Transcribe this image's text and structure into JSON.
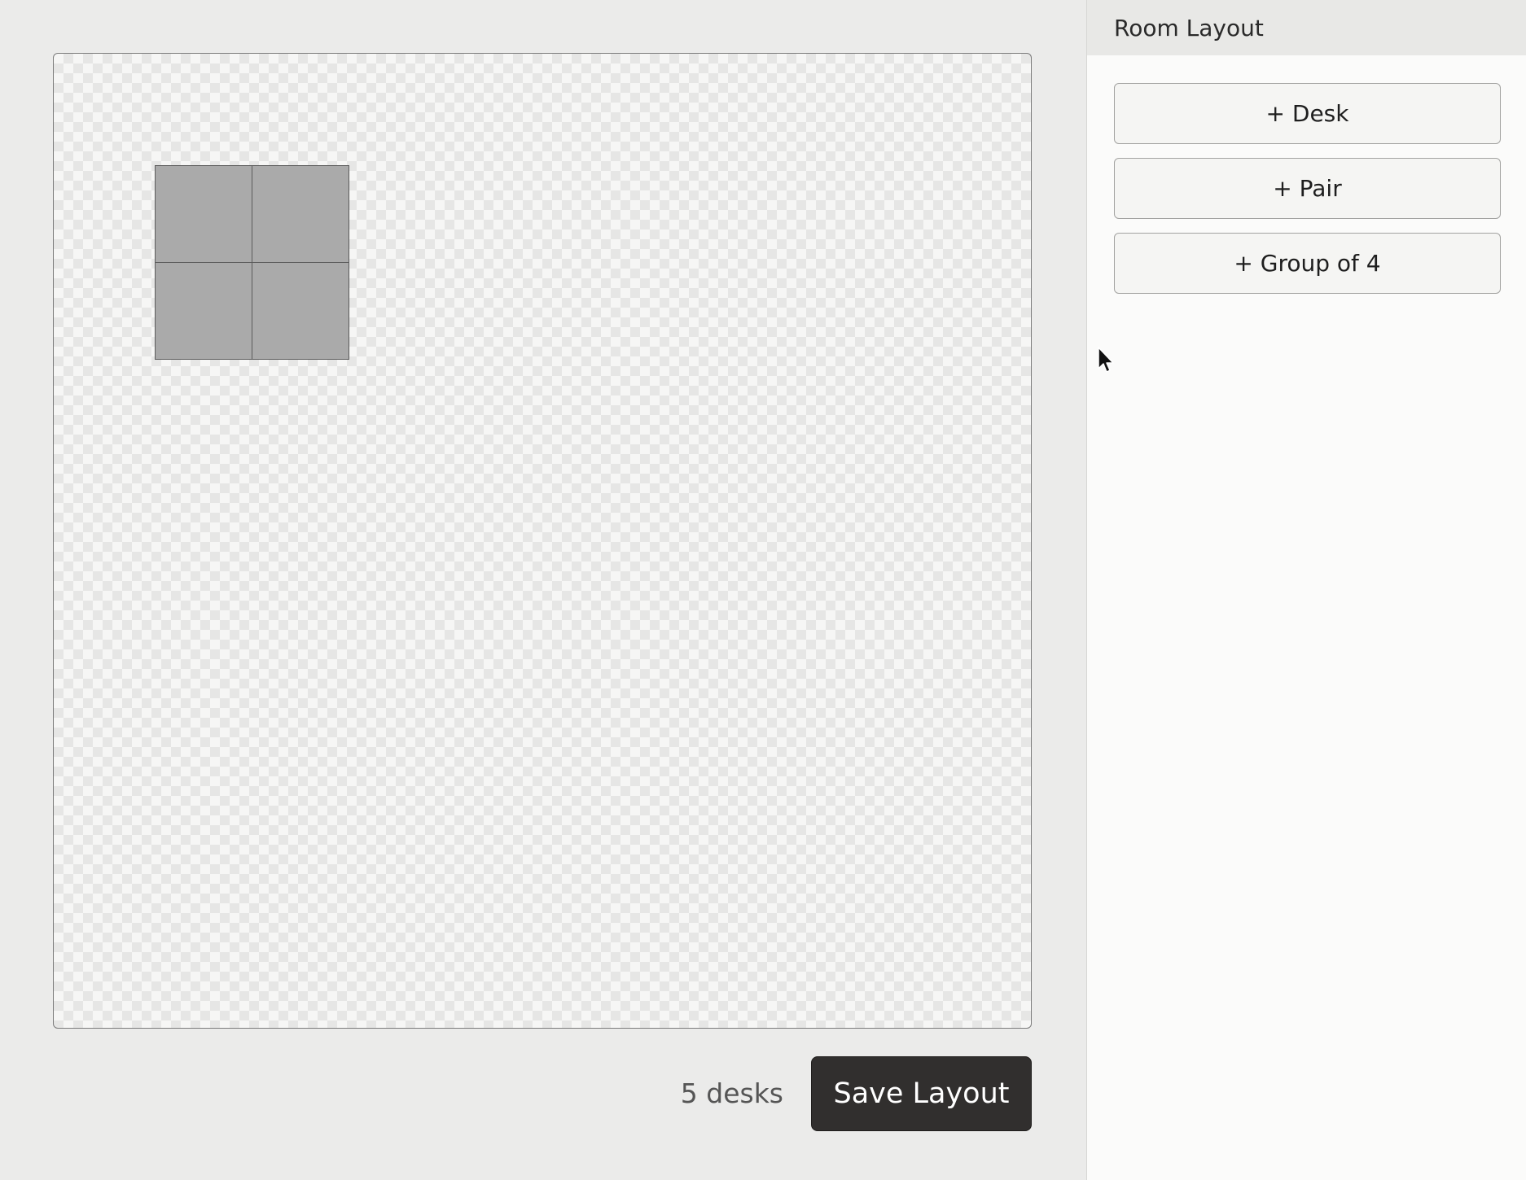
{
  "panel": {
    "title": "Room Layout",
    "buttons": [
      {
        "label": "+ Desk"
      },
      {
        "label": "+ Pair"
      },
      {
        "label": "+ Group of 4"
      }
    ]
  },
  "footer": {
    "desk_count": "5 desks",
    "save_label": "Save Layout"
  },
  "icons": {
    "cursor": "mouse-pointer-icon"
  },
  "colors": {
    "desk_fill": "#aaaaaa",
    "save_button_bg": "#312f2e"
  }
}
